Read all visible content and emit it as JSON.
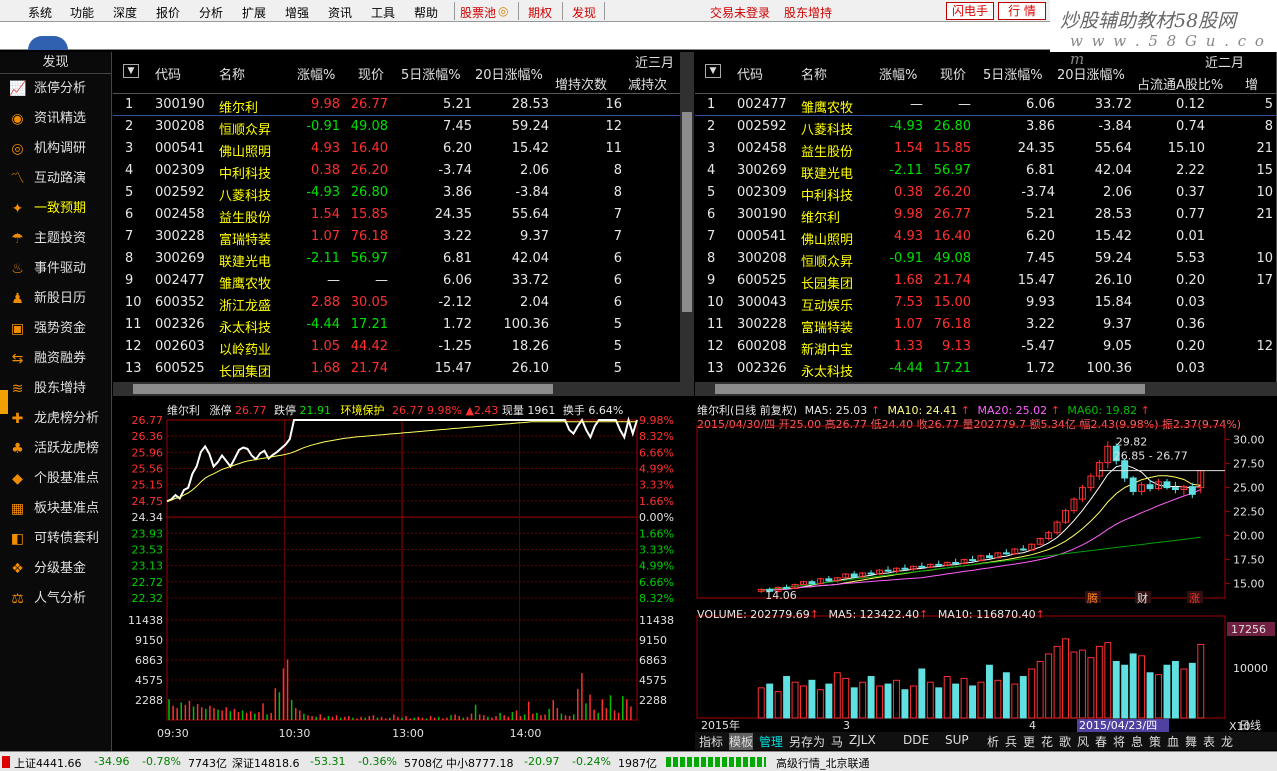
{
  "menu": {
    "items": [
      "系统",
      "功能",
      "深度",
      "报价",
      "分析",
      "扩展",
      "增强",
      "资讯",
      "工具",
      "帮助"
    ],
    "pool": "股票池",
    "qiquan": "期权",
    "faxian": "发现",
    "login": "交易未登录",
    "holders": "股东增持",
    "shandian": "闪电手",
    "hangqing": "行 情"
  },
  "logo": {
    "line1": "炒股辅助教材58股网",
    "line2": "w w w . 5 8 G u . c o m"
  },
  "sidebar": {
    "title": "发现",
    "items": [
      "涨停分析",
      "资讯精选",
      "机构调研",
      "互动路演",
      "一致预期",
      "主题投资",
      "事件驱动",
      "新股日历",
      "强势资金",
      "融资融券",
      "股东增持",
      "龙虎榜分析",
      "活跃龙虎榜",
      "个股基准点",
      "板块基准点",
      "可转债套利",
      "分级基金",
      "人气分析"
    ],
    "active_index": 4
  },
  "left_table": {
    "headers": [
      "代码",
      "名称",
      "涨幅%",
      "现价",
      "5日涨幅%",
      "20日涨幅%"
    ],
    "group": "近三月",
    "sub": [
      "增持次数",
      "减持次"
    ],
    "rows": [
      [
        "1",
        "300190",
        "维尔利",
        "9.98",
        "26.77",
        "5.21",
        "28.53",
        "16"
      ],
      [
        "2",
        "300208",
        "恒顺众昇",
        "-0.91",
        "49.08",
        "7.45",
        "59.24",
        "12"
      ],
      [
        "3",
        "000541",
        "佛山照明",
        "4.93",
        "16.40",
        "6.20",
        "15.42",
        "11"
      ],
      [
        "4",
        "002309",
        "中利科技",
        "0.38",
        "26.20",
        "-3.74",
        "2.06",
        "8"
      ],
      [
        "5",
        "002592",
        "八菱科技",
        "-4.93",
        "26.80",
        "3.86",
        "-3.84",
        "8"
      ],
      [
        "6",
        "002458",
        "益生股份",
        "1.54",
        "15.85",
        "24.35",
        "55.64",
        "7"
      ],
      [
        "7",
        "300228",
        "富瑞特装",
        "1.07",
        "76.18",
        "3.22",
        "9.37",
        "7"
      ],
      [
        "8",
        "300269",
        "联建光电",
        "-2.11",
        "56.97",
        "6.81",
        "42.04",
        "6"
      ],
      [
        "9",
        "002477",
        "雏鹰农牧",
        "—",
        "—",
        "6.06",
        "33.72",
        "6"
      ],
      [
        "10",
        "600352",
        "浙江龙盛",
        "2.88",
        "30.05",
        "-2.12",
        "2.04",
        "6"
      ],
      [
        "11",
        "002326",
        "永太科技",
        "-4.44",
        "17.21",
        "1.72",
        "100.36",
        "5"
      ],
      [
        "12",
        "002603",
        "以岭药业",
        "1.05",
        "44.42",
        "-1.25",
        "18.26",
        "5"
      ],
      [
        "13",
        "600525",
        "长园集团",
        "1.68",
        "21.74",
        "15.47",
        "26.10",
        "5"
      ]
    ]
  },
  "right_table": {
    "headers": [
      "代码",
      "名称",
      "涨幅%",
      "现价",
      "5日涨幅%",
      "20日涨幅%"
    ],
    "group": "近二月",
    "sub": [
      "占流通A股比%",
      "增"
    ],
    "rows": [
      [
        "1",
        "002477",
        "雏鹰农牧",
        "—",
        "—",
        "6.06",
        "33.72",
        "0.12",
        "5"
      ],
      [
        "2",
        "002592",
        "八菱科技",
        "-4.93",
        "26.80",
        "3.86",
        "-3.84",
        "0.74",
        "8"
      ],
      [
        "3",
        "002458",
        "益生股份",
        "1.54",
        "15.85",
        "24.35",
        "55.64",
        "15.10",
        "21"
      ],
      [
        "4",
        "300269",
        "联建光电",
        "-2.11",
        "56.97",
        "6.81",
        "42.04",
        "2.22",
        "15"
      ],
      [
        "5",
        "002309",
        "中利科技",
        "0.38",
        "26.20",
        "-3.74",
        "2.06",
        "0.37",
        "10"
      ],
      [
        "6",
        "300190",
        "维尔利",
        "9.98",
        "26.77",
        "5.21",
        "28.53",
        "0.77",
        "21"
      ],
      [
        "7",
        "000541",
        "佛山照明",
        "4.93",
        "16.40",
        "6.20",
        "15.42",
        "0.01",
        ""
      ],
      [
        "8",
        "300208",
        "恒顺众昇",
        "-0.91",
        "49.08",
        "7.45",
        "59.24",
        "5.53",
        "10"
      ],
      [
        "9",
        "600525",
        "长园集团",
        "1.68",
        "21.74",
        "15.47",
        "26.10",
        "0.20",
        "17"
      ],
      [
        "10",
        "300043",
        "互动娱乐",
        "7.53",
        "15.00",
        "9.93",
        "15.84",
        "0.03",
        ""
      ],
      [
        "11",
        "300228",
        "富瑞特装",
        "1.07",
        "76.18",
        "3.22",
        "9.37",
        "0.36",
        ""
      ],
      [
        "12",
        "600208",
        "新湖中宝",
        "1.33",
        "9.13",
        "-5.47",
        "9.05",
        "0.20",
        "12"
      ],
      [
        "13",
        "002326",
        "永太科技",
        "-4.44",
        "17.21",
        "1.72",
        "100.36",
        "0.03",
        ""
      ]
    ]
  },
  "intraday": {
    "name": "维尔利",
    "zt_label": "涨停",
    "zt": "26.77",
    "dt_label": "跌停",
    "dt": "21.91",
    "env": "环境保护",
    "price": "26.77",
    "pct": "9.98%",
    "chg": "▲2.43",
    "vol": "现量 1961",
    "turn": "换手 6.64%",
    "price_ticks": [
      "26.77",
      "26.36",
      "25.96",
      "25.56",
      "25.15",
      "24.75",
      "24.34",
      "23.93",
      "23.53",
      "23.13",
      "22.72",
      "22.32"
    ],
    "pct_ticks": [
      "9.98%",
      "8.32%",
      "6.66%",
      "4.99%",
      "3.33%",
      "1.66%",
      "0.00%",
      "1.66%",
      "3.33%",
      "4.99%",
      "6.66%",
      "8.32%"
    ],
    "vol_ticks": [
      "11438",
      "9150",
      "6863",
      "4575",
      "2288"
    ],
    "time_ticks": [
      "09:30",
      "10:30",
      "13:00",
      "14:00"
    ],
    "price_line": [
      24.55,
      24.6,
      24.72,
      24.63,
      24.86,
      24.92,
      25.3,
      25.5,
      25.9,
      26.05,
      25.85,
      25.5,
      25.62,
      25.8,
      25.65,
      25.5,
      25.72,
      25.95,
      26.02,
      25.98,
      25.8,
      25.7,
      25.86,
      25.93,
      25.72,
      25.82,
      25.9,
      26.0,
      26.1,
      26.25,
      26.77,
      26.77,
      26.77,
      26.77,
      26.77,
      26.77,
      26.77,
      26.77,
      26.77,
      26.77,
      26.77,
      26.77,
      26.77,
      26.77,
      26.77,
      26.77,
      26.77,
      26.77,
      26.77,
      26.77,
      26.77,
      26.77,
      26.77,
      26.77,
      26.77,
      26.77,
      26.77,
      26.77,
      26.77,
      26.77,
      26.77,
      26.77,
      26.77,
      26.77,
      26.77,
      26.77,
      26.77,
      26.77,
      26.77,
      26.77,
      26.77,
      26.77,
      26.77,
      26.77,
      26.77,
      26.77,
      26.77,
      26.77,
      26.77,
      26.77,
      26.77,
      26.77,
      26.77,
      26.77,
      26.77,
      26.77,
      26.77,
      26.77,
      26.77,
      26.77,
      26.77,
      26.77,
      26.77,
      26.77,
      26.77,
      26.5,
      26.4,
      26.6,
      26.77,
      26.5,
      26.3,
      26.6,
      26.77,
      26.77,
      26.77,
      26.77,
      26.77,
      26.5,
      26.3,
      26.77,
      26.4,
      26.77
    ],
    "avg_line": [
      24.55,
      24.58,
      24.63,
      24.66,
      24.72,
      24.78,
      24.86,
      24.96,
      25.08,
      25.18,
      25.25,
      25.3,
      25.36,
      25.42,
      25.46,
      25.5,
      25.54,
      25.58,
      25.62,
      25.65,
      25.67,
      25.69,
      25.71,
      25.73,
      25.75,
      25.77,
      25.79,
      25.81,
      25.83,
      25.86,
      25.9,
      25.95,
      26.0,
      26.04,
      26.08,
      26.11,
      26.14,
      26.17,
      26.19,
      26.21,
      26.23,
      26.25,
      26.27,
      26.28,
      26.3,
      26.31,
      26.32,
      26.33,
      26.34,
      26.35,
      26.36,
      26.37,
      26.38,
      26.39,
      26.4,
      26.41,
      26.42,
      26.43,
      26.44,
      26.45,
      26.46,
      26.47,
      26.48,
      26.49,
      26.5,
      26.51,
      26.52,
      26.53,
      26.54,
      26.55,
      26.56,
      26.57,
      26.58,
      26.59,
      26.6,
      26.61,
      26.62,
      26.63,
      26.64,
      26.65,
      26.66,
      26.67,
      26.68,
      26.69,
      26.7,
      26.71,
      26.72,
      26.72,
      26.72,
      26.72,
      26.72,
      26.72,
      26.72,
      26.72,
      26.72,
      26.72,
      26.72,
      26.72,
      26.72,
      26.72,
      26.72,
      26.72,
      26.72,
      26.72,
      26.72,
      26.72,
      26.72,
      26.72,
      26.72,
      26.72,
      26.72,
      26.72
    ],
    "vol_bars": [
      2600,
      1800,
      1500,
      2200,
      1900,
      2400,
      1700,
      2000,
      1600,
      1400,
      1800,
      1500,
      1300,
      1200,
      1600,
      1100,
      1400,
      1000,
      1200,
      900,
      1100,
      800,
      1000,
      2100,
      700,
      900,
      4000,
      3500,
      6500,
      7600,
      2500,
      1500,
      1200,
      800,
      600,
      500,
      400,
      700,
      300,
      500,
      400,
      600,
      300,
      400,
      500,
      300,
      200,
      400,
      300,
      500,
      600,
      300,
      400,
      200,
      300,
      700,
      400,
      300,
      500,
      200,
      300,
      400,
      300,
      200,
      500,
      300,
      400,
      200,
      300,
      600,
      700,
      500,
      300,
      400,
      800,
      1900,
      700,
      600,
      400,
      300,
      500,
      900,
      600,
      400,
      1000,
      1200,
      500,
      700,
      2300,
      800,
      900,
      600,
      700,
      1400,
      2500,
      1500,
      800,
      600,
      500,
      700,
      3900,
      5900,
      2100,
      3200,
      1300,
      900,
      2600,
      1500,
      3100,
      1200,
      900,
      3000,
      2600,
      1700
    ]
  },
  "kline": {
    "title": "维尔利(日线 前复权)",
    "ma5": "MA5: 25.03",
    "ma10": "MA10: 24.41",
    "ma20": "MA20: 25.02",
    "ma60": "MA60: 19.82",
    "info": "2015/04/30/四 开25.00 高26.77 低24.40 收26.77 量202779.7 额5.34亿 幅2.43(9.98%) 振2.37(9.74%)",
    "price_ticks": [
      "30.00",
      "27.50",
      "25.00",
      "22.50",
      "20.00",
      "17.50",
      "15.00"
    ],
    "hi_label": "29.82",
    "range_label": "26.85 - 26.77",
    "lo_label": "14.06",
    "events": [
      "腾",
      "财",
      "涨"
    ],
    "vol_title": "VOLUME: 202779.69",
    "vol_ma5": "MA5: 123422.40",
    "vol_ma10": "MA10: 116870.40",
    "vol_ticks": [
      "17256",
      "10000"
    ],
    "vol_unit": "X10",
    "time_ticks": [
      "2015年",
      "3",
      "4"
    ],
    "date_label": "2015/04/23/四",
    "period": "日线",
    "tabs": [
      "指标",
      "模板",
      "管理",
      "另存为",
      "马",
      "ZJLX",
      "DDE",
      "SUP",
      "析",
      "兵",
      "更",
      "花",
      "歌",
      "风",
      "春",
      "将",
      "息",
      "策",
      "血",
      "舞",
      "表",
      "龙"
    ],
    "candles": [
      [
        14.2,
        14.5,
        14.0,
        14.4
      ],
      [
        14.4,
        14.6,
        14.1,
        14.2
      ],
      [
        14.2,
        14.7,
        14.1,
        14.6
      ],
      [
        14.6,
        14.9,
        14.4,
        14.5
      ],
      [
        14.5,
        15.0,
        14.4,
        14.9
      ],
      [
        14.9,
        15.3,
        14.8,
        15.2
      ],
      [
        15.2,
        15.4,
        14.9,
        15.0
      ],
      [
        15.0,
        15.6,
        14.9,
        15.5
      ],
      [
        15.5,
        15.8,
        15.2,
        15.3
      ],
      [
        15.3,
        15.7,
        15.1,
        15.6
      ],
      [
        15.6,
        16.1,
        15.5,
        16.0
      ],
      [
        16.0,
        16.3,
        15.6,
        15.7
      ],
      [
        15.7,
        16.2,
        15.6,
        16.1
      ],
      [
        16.1,
        16.4,
        15.9,
        16.0
      ],
      [
        16.0,
        16.5,
        15.9,
        16.4
      ],
      [
        16.4,
        16.8,
        16.2,
        16.3
      ],
      [
        16.3,
        16.7,
        16.1,
        16.6
      ],
      [
        16.6,
        17.0,
        16.4,
        16.5
      ],
      [
        16.5,
        16.9,
        16.3,
        16.8
      ],
      [
        16.8,
        17.2,
        16.6,
        16.7
      ],
      [
        16.7,
        17.1,
        16.6,
        17.0
      ],
      [
        17.0,
        17.4,
        16.8,
        16.9
      ],
      [
        16.9,
        17.3,
        16.8,
        17.2
      ],
      [
        17.2,
        17.6,
        17.0,
        17.1
      ],
      [
        17.1,
        17.6,
        17.0,
        17.5
      ],
      [
        17.5,
        17.9,
        17.3,
        17.4
      ],
      [
        17.4,
        18.0,
        17.3,
        17.9
      ],
      [
        17.9,
        18.2,
        17.6,
        17.7
      ],
      [
        17.7,
        18.3,
        17.6,
        18.2
      ],
      [
        18.2,
        18.6,
        18.0,
        18.1
      ],
      [
        18.1,
        18.7,
        18.0,
        18.6
      ],
      [
        18.6,
        19.0,
        18.4,
        18.5
      ],
      [
        18.5,
        19.2,
        18.4,
        19.1
      ],
      [
        19.1,
        19.8,
        19.0,
        19.7
      ],
      [
        19.7,
        20.5,
        19.5,
        20.3
      ],
      [
        20.3,
        21.6,
        20.1,
        21.4
      ],
      [
        21.4,
        22.8,
        21.2,
        22.6
      ],
      [
        22.6,
        24.0,
        22.3,
        23.8
      ],
      [
        23.8,
        25.3,
        23.5,
        25.0
      ],
      [
        25.0,
        26.5,
        24.6,
        26.2
      ],
      [
        26.2,
        27.9,
        25.8,
        27.6
      ],
      [
        27.6,
        29.82,
        27.0,
        29.3
      ],
      [
        29.3,
        29.6,
        27.4,
        27.8
      ],
      [
        27.8,
        28.0,
        25.6,
        26.0
      ],
      [
        26.0,
        26.2,
        24.2,
        24.6
      ],
      [
        24.6,
        25.6,
        24.2,
        25.3
      ],
      [
        25.3,
        25.8,
        24.6,
        24.9
      ],
      [
        24.9,
        25.9,
        24.7,
        25.6
      ],
      [
        25.6,
        25.9,
        24.8,
        25.0
      ],
      [
        25.0,
        25.6,
        24.4,
        24.8
      ],
      [
        24.8,
        25.3,
        24.2,
        25.1
      ],
      [
        25.1,
        25.5,
        23.9,
        24.3
      ],
      [
        25.0,
        26.77,
        24.4,
        26.77
      ]
    ],
    "kvol": [
      80,
      90,
      70,
      110,
      95,
      85,
      100,
      75,
      90,
      120,
      105,
      80,
      95,
      110,
      85,
      90,
      100,
      75,
      85,
      130,
      95,
      80,
      110,
      90,
      105,
      85,
      95,
      140,
      100,
      120,
      90,
      110,
      130,
      150,
      170,
      190,
      210,
      175,
      180,
      160,
      190,
      200,
      150,
      140,
      170,
      165,
      120,
      115,
      140,
      150,
      130,
      145,
      195
    ]
  },
  "statusbar": {
    "sh": "上证4441.66",
    "sh_chg": "-34.96",
    "sh_pct": "-0.78%",
    "sh_amt": "7743亿",
    "sz": "深证14818.6",
    "sz_chg": "-53.31",
    "sz_pct": "-0.36%",
    "sz_amt": "5708亿",
    "zx": "中小8777.18",
    "zx_chg": "-20.97",
    "zx_pct": "-0.24%",
    "zx_amt": "1987亿",
    "feed": "高级行情_北京联通"
  }
}
